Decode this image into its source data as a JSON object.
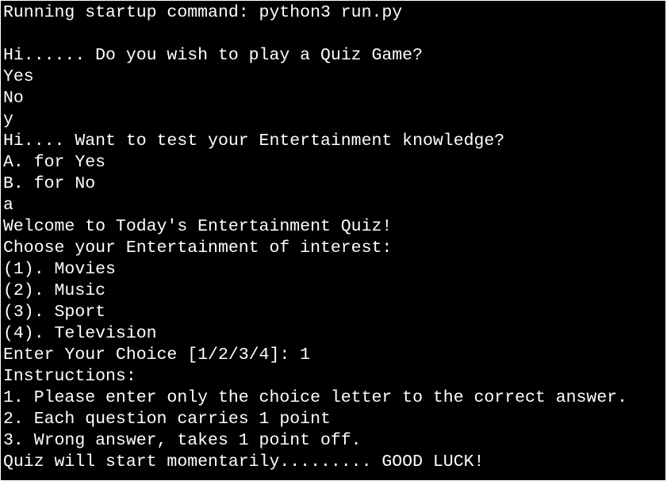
{
  "terminal": {
    "colors": {
      "background": "#000000",
      "text": "#ffffff"
    },
    "lines": [
      "Running startup command: python3 run.py",
      "",
      "Hi...... Do you wish to play a Quiz Game?",
      "Yes",
      "No",
      "y",
      "Hi.... Want to test your Entertainment knowledge?",
      "A. for Yes",
      "B. for No",
      "a",
      "Welcome to Today's Entertainment Quiz!",
      "Choose your Entertainment of interest:",
      "(1). Movies",
      "(2). Music",
      "(3). Sport",
      "(4). Television",
      "Enter Your Choice [1/2/3/4]: 1",
      "Instructions:",
      "1. Please enter only the choice letter to the correct answer.",
      "2. Each question carries 1 point",
      "3. Wrong answer, takes 1 point off.",
      "Quiz will start momentarily......... GOOD LUCK!"
    ]
  }
}
